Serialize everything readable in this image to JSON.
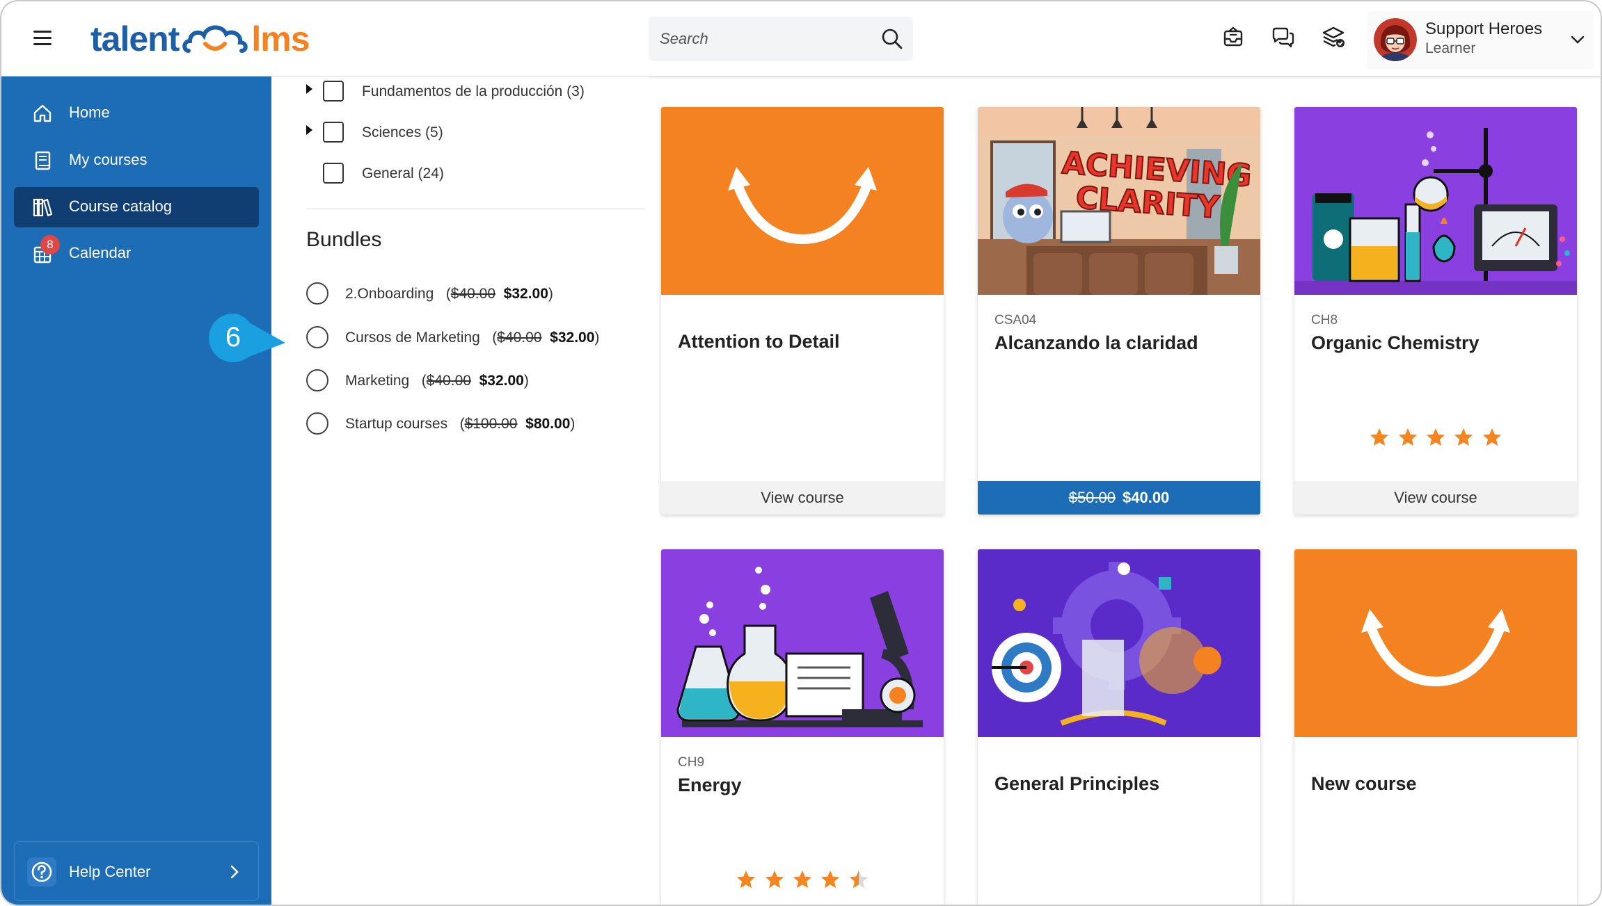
{
  "header": {
    "logo_left": "talent",
    "logo_right": "lms",
    "search_placeholder": "Search",
    "user_name": "Support Heroes",
    "user_role": "Learner"
  },
  "sidebar": {
    "items": [
      {
        "label": "Home",
        "icon": "home-icon"
      },
      {
        "label": "My courses",
        "icon": "book-icon"
      },
      {
        "label": "Course catalog",
        "icon": "library-icon",
        "active": true
      },
      {
        "label": "Calendar",
        "icon": "calendar-icon",
        "badge": "8"
      }
    ],
    "help_label": "Help Center"
  },
  "filters": {
    "categories": [
      {
        "label": "Fundamentos de la producción (3)",
        "expandable": true
      },
      {
        "label": "Sciences (5)",
        "expandable": true
      },
      {
        "label": "General (24)",
        "expandable": false
      }
    ],
    "bundles_title": "Bundles",
    "bundles": [
      {
        "name": "2.Onboarding",
        "old_price": "$40.00",
        "price": "$32.00"
      },
      {
        "name": "Cursos de Marketing",
        "old_price": "$40.00",
        "price": "$32.00"
      },
      {
        "name": "Marketing",
        "old_price": "$40.00",
        "price": "$32.00"
      },
      {
        "name": "Startup courses",
        "old_price": "$100.00",
        "price": "$80.00"
      }
    ]
  },
  "callout": {
    "number": "6",
    "color": "#1aa0e0"
  },
  "courses": [
    {
      "code": "",
      "title": "Attention to Detail",
      "footer": "View course",
      "rating": null,
      "thumb": "orange-smile"
    },
    {
      "code": "CSA04",
      "title": "Alcanzando la claridad",
      "old_price": "$50.00",
      "price": "$40.00",
      "rating": null,
      "thumb": "achieving-clarity",
      "thumb_text": [
        "ACHIEVING",
        "CLARITY"
      ]
    },
    {
      "code": "CH8",
      "title": "Organic Chemistry",
      "footer": "View course",
      "rating": 5,
      "thumb": "lab-purple"
    },
    {
      "code": "CH9",
      "title": "Energy",
      "footer": "",
      "rating": 4.5,
      "thumb": "microscope-purple"
    },
    {
      "code": "",
      "title": "General Principles",
      "footer": "",
      "rating": null,
      "thumb": "gears-purple"
    },
    {
      "code": "",
      "title": "New course",
      "footer": "",
      "rating": null,
      "thumb": "orange-smile"
    }
  ],
  "colors": {
    "brand_blue": "#1c6cb6",
    "active_nav": "#103e72",
    "orange": "#f58220",
    "purple": "#8a3fe0",
    "star": "#f5851f"
  }
}
